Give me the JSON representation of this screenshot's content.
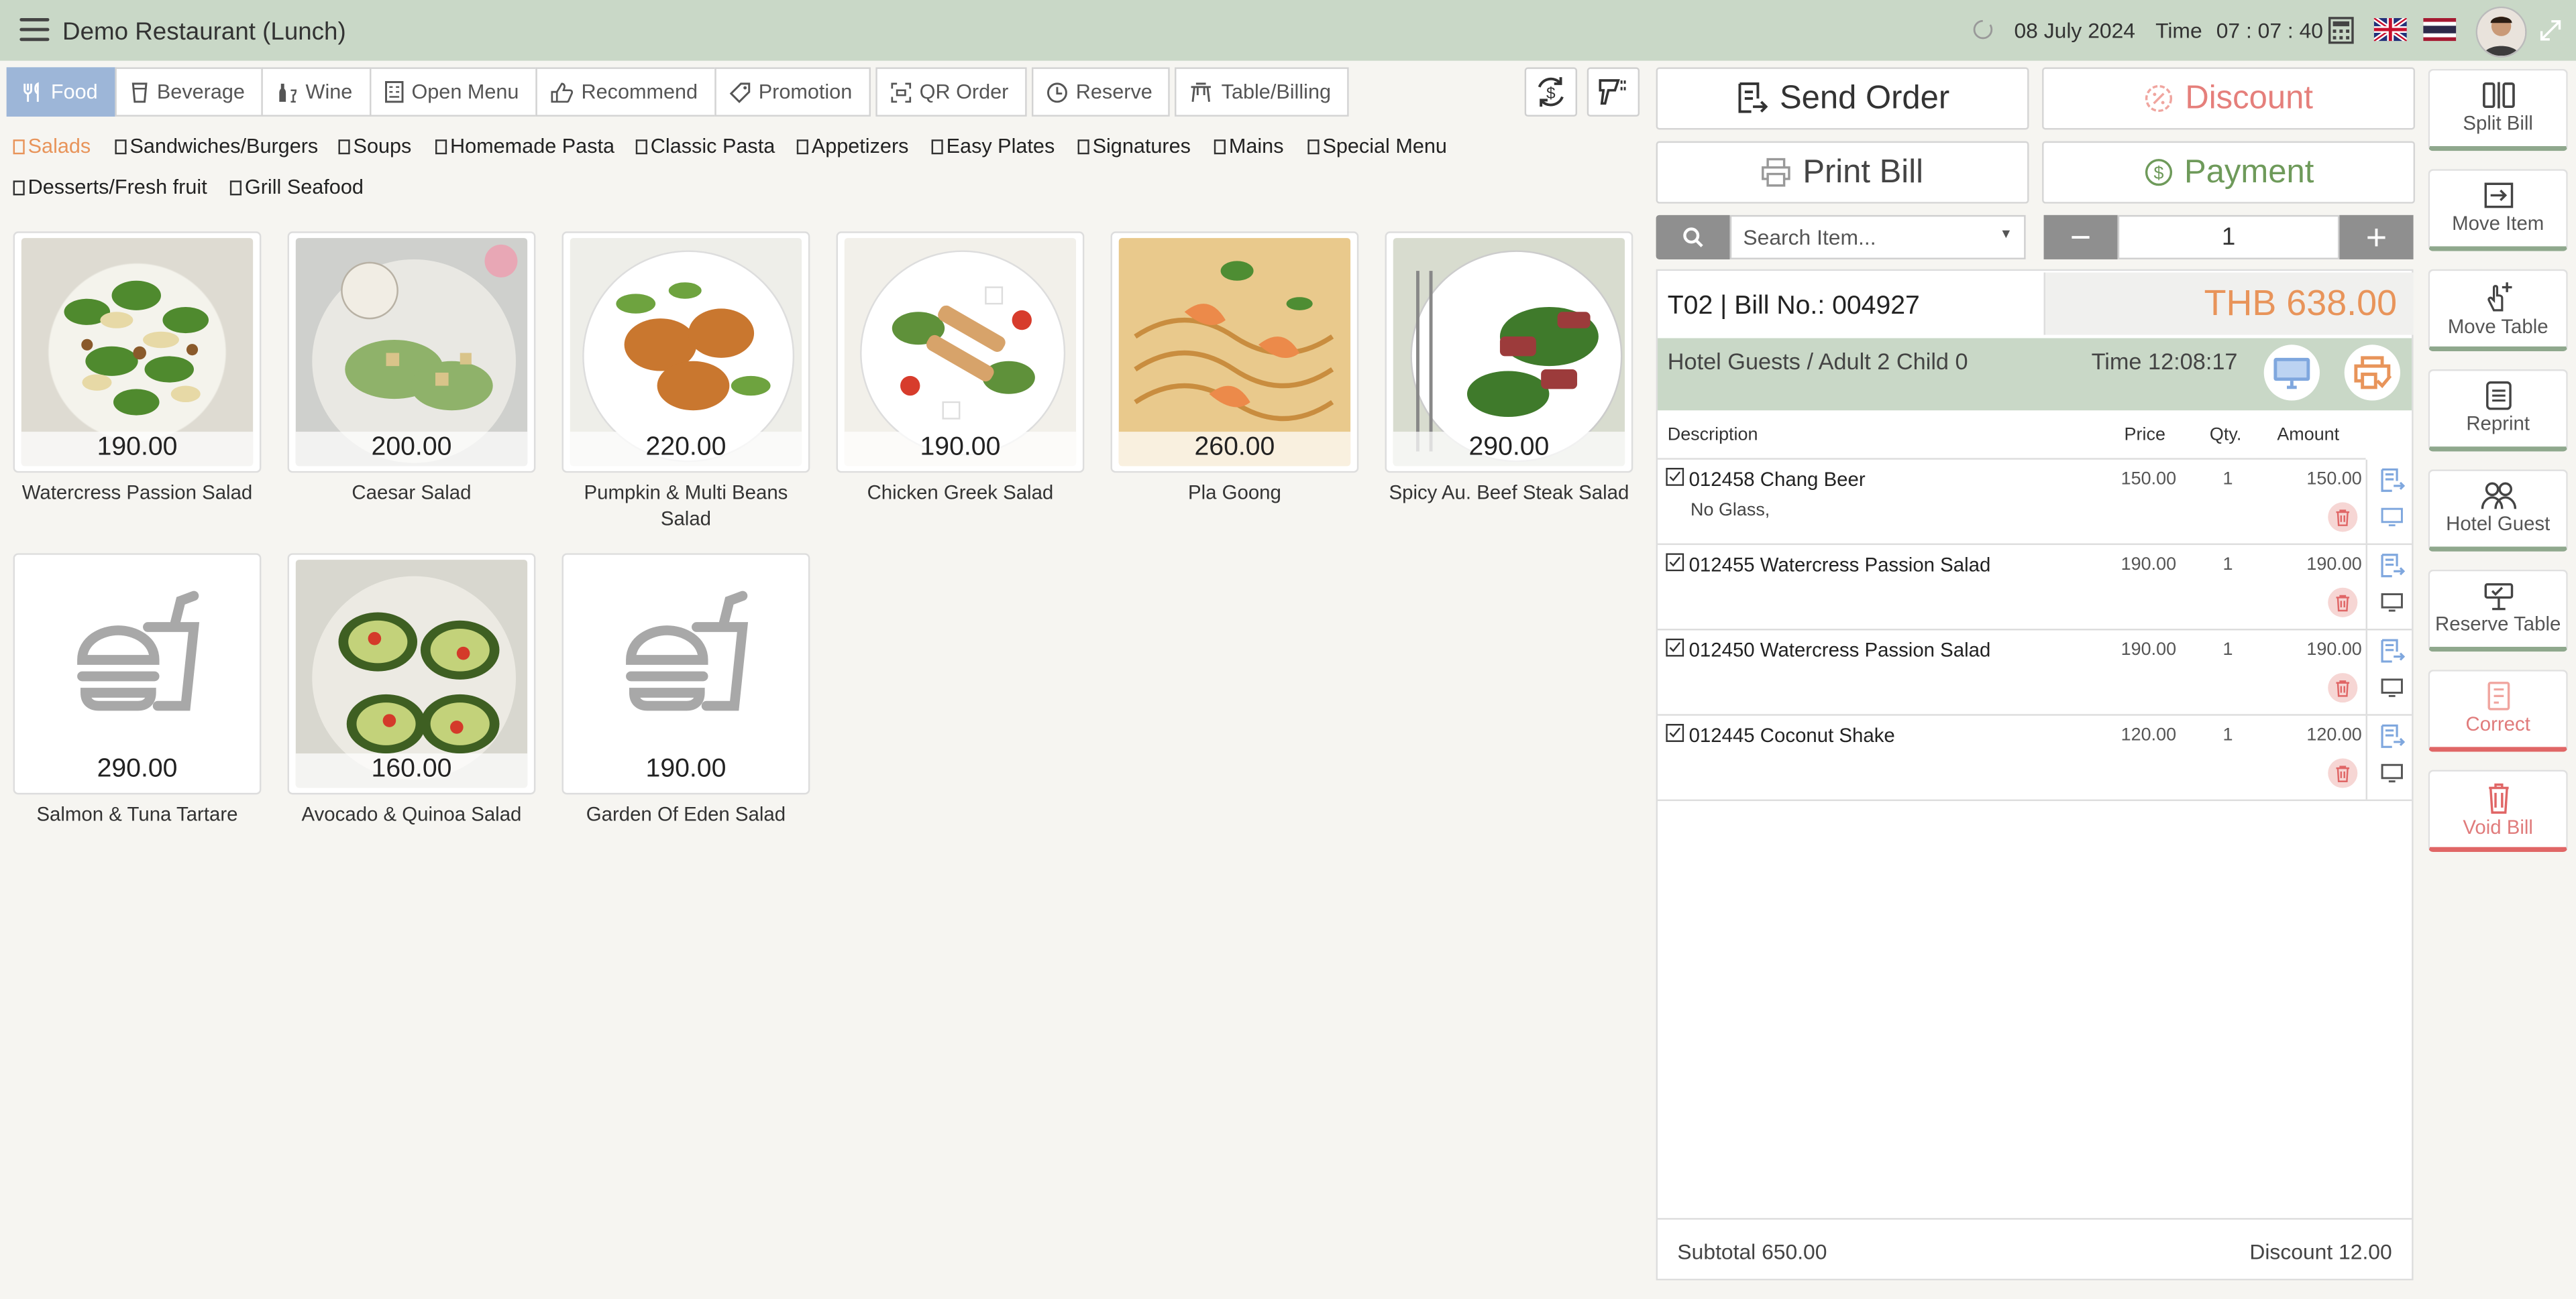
{
  "header": {
    "title": "Demo Restaurant (Lunch)",
    "date": "08 July 2024",
    "time_label": "Time",
    "time": "07 : 07 : 40"
  },
  "tabs": [
    {
      "label": "Food",
      "icon": "utensils-icon",
      "active": true
    },
    {
      "label": "Beverage",
      "icon": "cup-icon"
    },
    {
      "label": "Wine",
      "icon": "wine-icon"
    },
    {
      "label": "Open Menu",
      "icon": "menu-doc-icon"
    },
    {
      "label": "Recommend",
      "icon": "thumbs-up-icon"
    },
    {
      "label": "Promotion",
      "icon": "tag-icon"
    },
    {
      "label": "QR Order",
      "icon": "qr-icon"
    },
    {
      "label": "Reserve",
      "icon": "clock-icon"
    },
    {
      "label": "Table/Billing",
      "icon": "table-icon"
    }
  ],
  "subcategories": [
    {
      "label": "Salads",
      "active": true
    },
    {
      "label": "Sandwiches/Burgers"
    },
    {
      "label": "Soups"
    },
    {
      "label": "Homemade Pasta"
    },
    {
      "label": "Classic Pasta"
    },
    {
      "label": "Appetizers"
    },
    {
      "label": "Easy Plates"
    },
    {
      "label": "Signatures"
    },
    {
      "label": "Mains"
    },
    {
      "label": "Special Menu"
    },
    {
      "label": "Desserts/Fresh fruit"
    },
    {
      "label": "Grill Seafood"
    }
  ],
  "products": [
    {
      "name": "Watercress Passion Salad",
      "price": "190.00"
    },
    {
      "name": "Caesar Salad",
      "price": "200.00"
    },
    {
      "name": "Pumpkin & Multi Beans Salad",
      "price": "220.00"
    },
    {
      "name": "Chicken Greek Salad",
      "price": "190.00"
    },
    {
      "name": "Pla Goong",
      "price": "260.00"
    },
    {
      "name": "Spicy Au. Beef Steak Salad",
      "price": "290.00"
    },
    {
      "name": "Salmon & Tuna Tartare",
      "price": "290.00"
    },
    {
      "name": "Avocado & Quinoa Salad",
      "price": "160.00"
    },
    {
      "name": "Garden Of Eden Salad",
      "price": "190.00"
    }
  ],
  "actions": {
    "send_order": "Send Order",
    "discount": "Discount",
    "print_bill": "Print Bill",
    "payment": "Payment"
  },
  "search": {
    "placeholder": "Search Item..."
  },
  "quantity": "1",
  "bill": {
    "label": "T02 | Bill No.: 004927",
    "total": "THB 638.00",
    "guest": "Hotel Guests / Adult 2 Child 0",
    "time": "Time 12:08:17",
    "columns": {
      "description": "Description",
      "price": "Price",
      "qty": "Qty.",
      "amount": "Amount"
    },
    "items": [
      {
        "code_name": "012458 Chang Beer",
        "note": "No Glass,",
        "price": "150.00",
        "qty": "1",
        "amount": "150.00"
      },
      {
        "code_name": "012455 Watercress Passion Salad",
        "note": "",
        "price": "190.00",
        "qty": "1",
        "amount": "190.00"
      },
      {
        "code_name": "012450 Watercress Passion Salad",
        "note": "",
        "price": "190.00",
        "qty": "1",
        "amount": "190.00"
      },
      {
        "code_name": "012445 Coconut Shake",
        "note": "",
        "price": "120.00",
        "qty": "1",
        "amount": "120.00"
      }
    ],
    "subtotal": "Subtotal 650.00",
    "discount": "Discount 12.00"
  },
  "side_actions": [
    {
      "label": "Split Bill",
      "icon": "split-bill-icon"
    },
    {
      "label": "Move Item",
      "icon": "move-item-icon"
    },
    {
      "label": "Move Table",
      "icon": "move-table-icon"
    },
    {
      "label": "Reprint",
      "icon": "reprint-icon"
    },
    {
      "label": "Hotel Guest",
      "icon": "hotel-guest-icon"
    },
    {
      "label": "Reserve Table",
      "icon": "reserve-table-icon"
    },
    {
      "label": "Correct",
      "icon": "correct-icon"
    },
    {
      "label": "Void Bill",
      "icon": "void-bill-icon"
    }
  ],
  "colors": {
    "accent_green": "#8fa88d",
    "header_bg": "#c9d8c7",
    "active_tab": "#9db6d8",
    "orange": "#e8945a",
    "red": "#e06666"
  }
}
